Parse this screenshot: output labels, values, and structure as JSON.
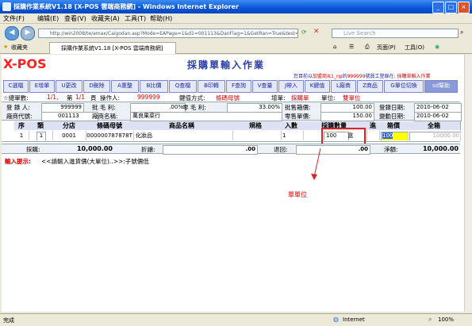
{
  "window": {
    "title": "採購作業系統V1.18 [X-POS 雲端商務網] - Windows Internet Explorer",
    "minimize": "_",
    "maximize": "□",
    "close": "×"
  },
  "menu": [
    "文件(F)",
    "编辑(E)",
    "查看(V)",
    "收藏夹(A)",
    "工具(T)",
    "帮助(H)"
  ],
  "address": {
    "url": "http://win2008/te/amax/Caigodan.asp?Mode=EAPage=1&d1=001113&DanFlag=1&GetRan=True&test=8",
    "search_placeholder": "Live Search"
  },
  "favorites_label": "收藏夹",
  "tab_title": "採購作業系統V1.18 [X-POS 雲端商務網]",
  "ie_tools": {
    "page": "页面(P)",
    "tools": "工具(O)"
  },
  "app": {
    "logo": "X-POS",
    "title": "採購單輸入作業",
    "info_prefix": "您目前以",
    "info_user": "加盟商ik1_np",
    "info_mid": "的",
    "info_emp": "999999",
    "info_role": "號員工登錄在: ",
    "info_page": "採購單輸入作業"
  },
  "toolbar": [
    "C選檔",
    "E增單",
    "U更改",
    "D刪除",
    "A重整",
    "B比價",
    "Q查檔",
    "B印轉",
    "F查詢",
    "V查量",
    "J帶入",
    "K鍵值",
    "L廠商",
    "Z商品",
    "G單位切換",
    "sd幫助"
  ],
  "summary": {
    "total_label": "☆總單數:",
    "total_value": "1/1,",
    "page_label": "第",
    "page_value": "1/1",
    "page_unit": "頁",
    "operator_label": "操作人:",
    "operator_value": "999999",
    "key_label": "鍵值方式:",
    "key_value": "條碼母號",
    "add_label": "增單:",
    "add_value": "採購單",
    "unit_label": "單位:",
    "unit_value": "雙單位"
  },
  "form": {
    "entry_label": "登 錄 人:",
    "entry_value": "999999",
    "margin_label": "批 毛 利:",
    "margin_value": ".00%",
    "zero_label": "零 毛 利:",
    "zero_value": "33.00%",
    "wholesale_label": "批售箱價:",
    "wholesale_value": "100.00",
    "regdate_label": "登錄日期:",
    "regdate_value": "2010-06-02",
    "vendor_code_label": "廠商代號:",
    "vendor_code_value": "001113",
    "vendor_name_label": "廠商名稱:",
    "vendor_name_value": "萬良果菜行",
    "retail_label": "零售單價:",
    "retail_value": "150.00",
    "change_label": "變動日期:",
    "change_value": "2010-06-02"
  },
  "table": {
    "headers": [
      "序",
      "類",
      "分店",
      "條碼母號",
      "商品名稱",
      "規格",
      "入數",
      "採購數量",
      "進",
      "箱價",
      "全箱"
    ],
    "row": {
      "seq": "1",
      "type": "1",
      "branch": "0001",
      "barcode": "000000787878T",
      "name": "化妝品",
      "spec": "",
      "qty_in": "1",
      "purchase_qty": "100",
      "unit": "盒",
      "box_price": "100",
      "full_box": "10000.00"
    }
  },
  "totals": {
    "purchase_label": "採購:",
    "purchase_value": "10,000.00",
    "discount_label": "折讓:",
    "discount_value": ".00",
    "return_label": "退回:",
    "return_value": ".00",
    "net_label": "淨額:",
    "net_value": "10,000.00"
  },
  "hint": {
    "label": "輸入提示:",
    "text": "<<請輸入進貨價(大單位)..>>:子號價低"
  },
  "annotation": "單單位",
  "statusbar": {
    "left": "完成",
    "zone": "Internet",
    "zoom": "100%"
  },
  "colors": {
    "titlebar": "#0a56d8",
    "accent_red": "#dd0000",
    "annotation_box": "#e02020",
    "highlight_yellow": "#ffff00"
  }
}
